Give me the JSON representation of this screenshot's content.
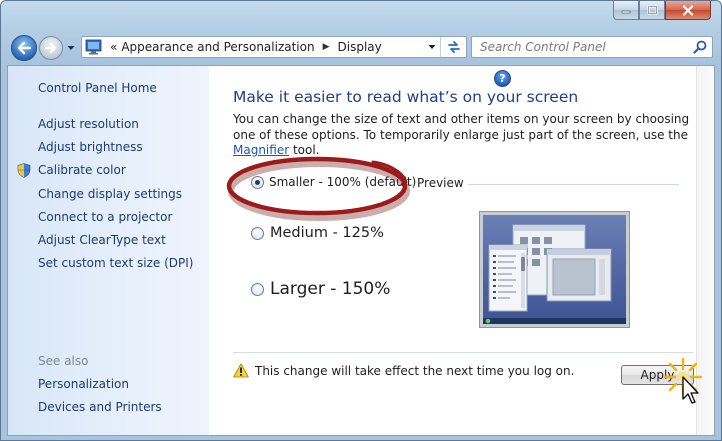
{
  "nav": {
    "breadcrumb_overflow": "«",
    "breadcrumbs": [
      "Appearance and Personalization",
      "Display"
    ],
    "search_placeholder": "Search Control Panel"
  },
  "sidebar": {
    "home": "Control Panel Home",
    "links": [
      "Adjust resolution",
      "Adjust brightness",
      "Calibrate color",
      "Change display settings",
      "Connect to a projector",
      "Adjust ClearType text",
      "Set custom text size (DPI)"
    ],
    "see_also_label": "See also",
    "see_also_links": [
      "Personalization",
      "Devices and Printers"
    ]
  },
  "main": {
    "title": "Make it easier to read what’s on your screen",
    "description_1": "You can change the size of text and other items on your screen by choosing one of these options. To temporarily enlarge just part of the screen, use the ",
    "magnifier_link": "Magnifier",
    "description_2": " tool.",
    "help": "?",
    "options": [
      {
        "label": "Smaller - 100% (default)",
        "selected": true
      },
      {
        "label": "Medium - 125%",
        "selected": false
      },
      {
        "label": "Larger - 150%",
        "selected": false
      }
    ],
    "preview_label": "Preview",
    "warning": "This change will take effect the next time you log on.",
    "apply_label": "Apply"
  },
  "colors": {
    "link": "#1e3a6e",
    "title": "#1f3f8c",
    "annotation_ellipse": "#9b1b1b"
  }
}
